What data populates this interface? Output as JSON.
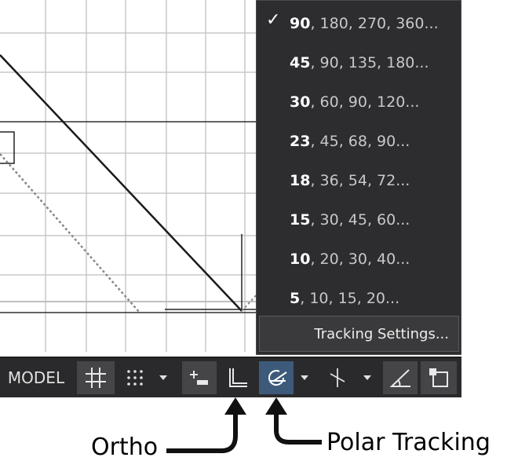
{
  "menu": {
    "items": [
      {
        "hl": "90",
        "rest": ", 180, 270, 360...",
        "checked": true
      },
      {
        "hl": "45",
        "rest": ", 90, 135, 180...",
        "checked": false
      },
      {
        "hl": "30",
        "rest": ", 60, 90, 120...",
        "checked": false
      },
      {
        "hl": "23",
        "rest": ", 45, 68, 90...",
        "checked": false
      },
      {
        "hl": "18",
        "rest": ", 36, 54, 72...",
        "checked": false
      },
      {
        "hl": "15",
        "rest": ", 30, 45, 60...",
        "checked": false
      },
      {
        "hl": "10",
        "rest": ", 20, 30, 40...",
        "checked": false
      },
      {
        "hl": "5",
        "rest": ", 10, 15, 20...",
        "checked": false
      }
    ],
    "check_mark": "✓",
    "settings_label": "Tracking Settings..."
  },
  "statusbar": {
    "model_label": "MODEL",
    "buttons": [
      "grid-icon",
      "snap-icon",
      "dropdown-arrow-icon",
      "infer-constraints-icon",
      "ortho-icon",
      "polar-tracking-icon",
      "dropdown-arrow-icon",
      "isodraft-icon",
      "dropdown-arrow-icon",
      "dynamic-ucs-icon",
      "object-snap-icon"
    ]
  },
  "captions": {
    "ortho": "Ortho",
    "polar": "Polar Tracking"
  },
  "colors": {
    "menu_bg": "#2d2d30",
    "statusbar_bg": "#2a2a2c",
    "active_button": "#3d5a7a"
  }
}
